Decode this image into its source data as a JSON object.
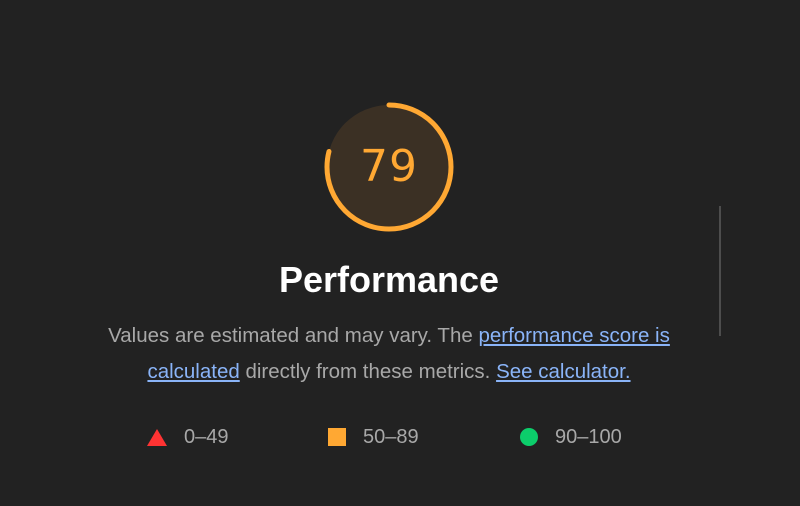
{
  "gauge": {
    "score": "79",
    "score_value": 79,
    "max": 100,
    "color": "#ffa833",
    "track_color": "#3b3024"
  },
  "category": {
    "title": "Performance"
  },
  "description": {
    "text_before": "Values are estimated and may vary. The ",
    "link1_label": "performance score is calculated",
    "text_middle": " directly from these metrics. ",
    "link2_label": "See calculator."
  },
  "legend": {
    "items": [
      {
        "range": "0–49",
        "shape": "triangle-icon",
        "color": "#ff3333"
      },
      {
        "range": "50–89",
        "shape": "square-icon",
        "color": "#ffa833"
      },
      {
        "range": "90–100",
        "shape": "circle-icon",
        "color": "#0cce6b"
      }
    ]
  },
  "colors": {
    "background": "#222222",
    "link": "#8ab4f8",
    "text_muted": "#a8a8a8"
  }
}
